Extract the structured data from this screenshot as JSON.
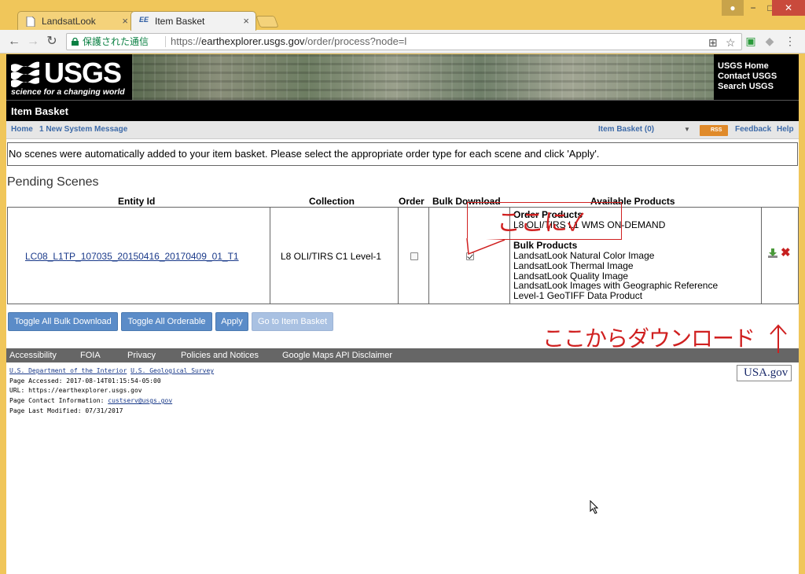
{
  "browser": {
    "tabs": [
      {
        "title": "LandsatLook",
        "close": "×"
      },
      {
        "title": "Item Basket",
        "close": "×"
      }
    ],
    "window_controls": {
      "minimize": "−",
      "maximize": "□",
      "close": "✕"
    },
    "address": {
      "secure_label": "保護された通信",
      "url_scheme": "https://",
      "url_host": "earthexplorer.usgs.gov",
      "url_path": "/order/process?node=l"
    }
  },
  "header": {
    "logo_text": "USGS",
    "tagline": "science for a changing world",
    "links": [
      "USGS Home",
      "Contact USGS",
      "Search USGS"
    ]
  },
  "page_title": "Item Basket",
  "nav": {
    "home": "Home",
    "message": "1 New System Message",
    "item_basket": "Item Basket (0)",
    "rss": "RSS",
    "feedback": "Feedback",
    "help": "Help"
  },
  "notice": "No scenes were automatically added to your item basket. Please select the appropriate order type for each scene and click 'Apply'.",
  "section_title": "Pending Scenes",
  "table": {
    "headers": [
      "Entity Id",
      "Collection",
      "Order",
      "Bulk Download",
      "Available Products"
    ],
    "row": {
      "entity_id": "LC08_L1TP_107035_20150416_20170409_01_T1",
      "collection": "L8 OLI/TIRS C1 Level-1",
      "order_checked": false,
      "bulk_checked": true,
      "order_products_title": "Order Products",
      "order_products": [
        "L8 OLI/TIRS L1 WMS ON-DEMAND"
      ],
      "bulk_products_title": "Bulk Products",
      "bulk_products": [
        "LandsatLook Natural Color Image",
        "LandsatLook Thermal Image",
        "LandsatLook Quality Image",
        "LandsatLook Images with Geographic Reference",
        "Level-1 GeoTIFF Data Product"
      ]
    }
  },
  "buttons": {
    "toggle_bulk": "Toggle All Bulk Download",
    "toggle_orderable": "Toggle All Orderable",
    "apply": "Apply",
    "go_to_basket": "Go to Item Basket"
  },
  "footer_links": [
    "Accessibility",
    "FOIA",
    "Privacy",
    "Policies and Notices",
    "Google Maps API Disclaimer"
  ],
  "footer": {
    "doi": "U.S. Department of the Interior",
    "usgs": "U.S. Geological Survey",
    "accessed": "Page Accessed: 2017-08-14T01:15:54-05:00",
    "url": "URL: https://earthexplorer.usgs.gov",
    "contact_label": "Page Contact Information:",
    "contact_email": "custserv@usgs.gov",
    "modified": "Page Last Modified: 07/31/2017",
    "usagov": "USA.gov"
  },
  "annotations": {
    "check_here": "ここに✓",
    "download_here": "ここからダウンロード"
  },
  "colors": {
    "accent": "#5b8cc8",
    "annotation": "#d02020",
    "chrome": "#f0c65a"
  }
}
